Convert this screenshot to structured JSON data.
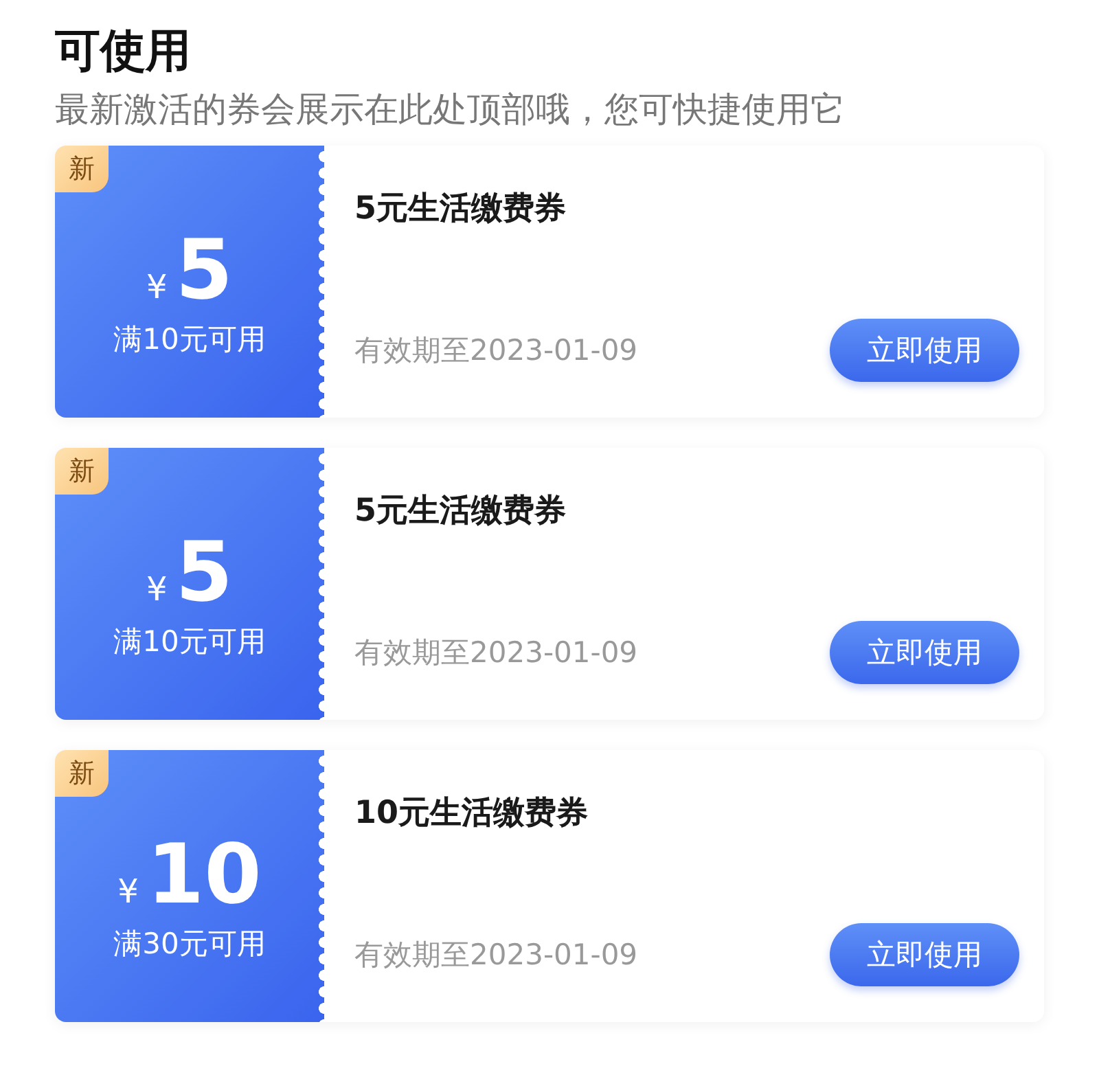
{
  "header": {
    "title": "可使用",
    "subtitle": "最新激活的券会展示在此处顶部哦，您可快捷使用它"
  },
  "coupons": [
    {
      "badge": "新",
      "currency": "¥",
      "amount": "5",
      "condition": "满10元可用",
      "name": "5元生活缴费券",
      "expiry": "有效期至2023-01-09",
      "button": "立即使用"
    },
    {
      "badge": "新",
      "currency": "¥",
      "amount": "5",
      "condition": "满10元可用",
      "name": "5元生活缴费券",
      "expiry": "有效期至2023-01-09",
      "button": "立即使用"
    },
    {
      "badge": "新",
      "currency": "¥",
      "amount": "10",
      "condition": "满30元可用",
      "name": "10元生活缴费券",
      "expiry": "有效期至2023-01-09",
      "button": "立即使用"
    }
  ]
}
